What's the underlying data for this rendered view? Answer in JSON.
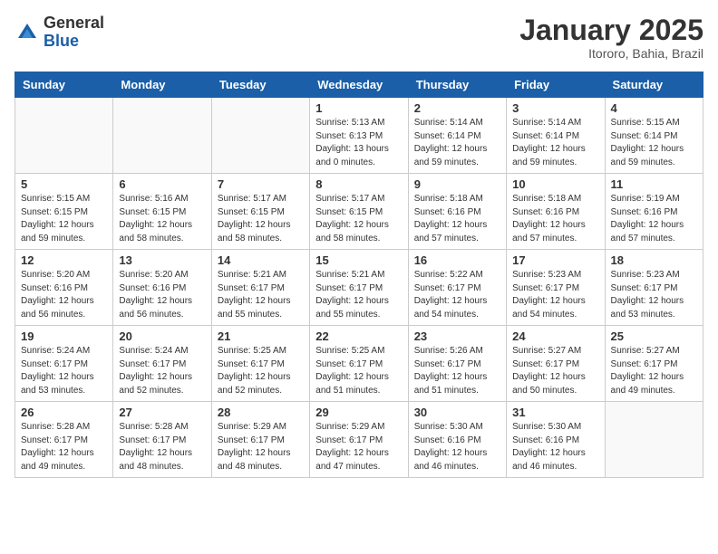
{
  "header": {
    "logo_general": "General",
    "logo_blue": "Blue",
    "month_title": "January 2025",
    "location": "Itororo, Bahia, Brazil"
  },
  "weekdays": [
    "Sunday",
    "Monday",
    "Tuesday",
    "Wednesday",
    "Thursday",
    "Friday",
    "Saturday"
  ],
  "weeks": [
    [
      {
        "day": "",
        "info": ""
      },
      {
        "day": "",
        "info": ""
      },
      {
        "day": "",
        "info": ""
      },
      {
        "day": "1",
        "info": "Sunrise: 5:13 AM\nSunset: 6:13 PM\nDaylight: 13 hours\nand 0 minutes."
      },
      {
        "day": "2",
        "info": "Sunrise: 5:14 AM\nSunset: 6:14 PM\nDaylight: 12 hours\nand 59 minutes."
      },
      {
        "day": "3",
        "info": "Sunrise: 5:14 AM\nSunset: 6:14 PM\nDaylight: 12 hours\nand 59 minutes."
      },
      {
        "day": "4",
        "info": "Sunrise: 5:15 AM\nSunset: 6:14 PM\nDaylight: 12 hours\nand 59 minutes."
      }
    ],
    [
      {
        "day": "5",
        "info": "Sunrise: 5:15 AM\nSunset: 6:15 PM\nDaylight: 12 hours\nand 59 minutes."
      },
      {
        "day": "6",
        "info": "Sunrise: 5:16 AM\nSunset: 6:15 PM\nDaylight: 12 hours\nand 58 minutes."
      },
      {
        "day": "7",
        "info": "Sunrise: 5:17 AM\nSunset: 6:15 PM\nDaylight: 12 hours\nand 58 minutes."
      },
      {
        "day": "8",
        "info": "Sunrise: 5:17 AM\nSunset: 6:15 PM\nDaylight: 12 hours\nand 58 minutes."
      },
      {
        "day": "9",
        "info": "Sunrise: 5:18 AM\nSunset: 6:16 PM\nDaylight: 12 hours\nand 57 minutes."
      },
      {
        "day": "10",
        "info": "Sunrise: 5:18 AM\nSunset: 6:16 PM\nDaylight: 12 hours\nand 57 minutes."
      },
      {
        "day": "11",
        "info": "Sunrise: 5:19 AM\nSunset: 6:16 PM\nDaylight: 12 hours\nand 57 minutes."
      }
    ],
    [
      {
        "day": "12",
        "info": "Sunrise: 5:20 AM\nSunset: 6:16 PM\nDaylight: 12 hours\nand 56 minutes."
      },
      {
        "day": "13",
        "info": "Sunrise: 5:20 AM\nSunset: 6:16 PM\nDaylight: 12 hours\nand 56 minutes."
      },
      {
        "day": "14",
        "info": "Sunrise: 5:21 AM\nSunset: 6:17 PM\nDaylight: 12 hours\nand 55 minutes."
      },
      {
        "day": "15",
        "info": "Sunrise: 5:21 AM\nSunset: 6:17 PM\nDaylight: 12 hours\nand 55 minutes."
      },
      {
        "day": "16",
        "info": "Sunrise: 5:22 AM\nSunset: 6:17 PM\nDaylight: 12 hours\nand 54 minutes."
      },
      {
        "day": "17",
        "info": "Sunrise: 5:23 AM\nSunset: 6:17 PM\nDaylight: 12 hours\nand 54 minutes."
      },
      {
        "day": "18",
        "info": "Sunrise: 5:23 AM\nSunset: 6:17 PM\nDaylight: 12 hours\nand 53 minutes."
      }
    ],
    [
      {
        "day": "19",
        "info": "Sunrise: 5:24 AM\nSunset: 6:17 PM\nDaylight: 12 hours\nand 53 minutes."
      },
      {
        "day": "20",
        "info": "Sunrise: 5:24 AM\nSunset: 6:17 PM\nDaylight: 12 hours\nand 52 minutes."
      },
      {
        "day": "21",
        "info": "Sunrise: 5:25 AM\nSunset: 6:17 PM\nDaylight: 12 hours\nand 52 minutes."
      },
      {
        "day": "22",
        "info": "Sunrise: 5:25 AM\nSunset: 6:17 PM\nDaylight: 12 hours\nand 51 minutes."
      },
      {
        "day": "23",
        "info": "Sunrise: 5:26 AM\nSunset: 6:17 PM\nDaylight: 12 hours\nand 51 minutes."
      },
      {
        "day": "24",
        "info": "Sunrise: 5:27 AM\nSunset: 6:17 PM\nDaylight: 12 hours\nand 50 minutes."
      },
      {
        "day": "25",
        "info": "Sunrise: 5:27 AM\nSunset: 6:17 PM\nDaylight: 12 hours\nand 49 minutes."
      }
    ],
    [
      {
        "day": "26",
        "info": "Sunrise: 5:28 AM\nSunset: 6:17 PM\nDaylight: 12 hours\nand 49 minutes."
      },
      {
        "day": "27",
        "info": "Sunrise: 5:28 AM\nSunset: 6:17 PM\nDaylight: 12 hours\nand 48 minutes."
      },
      {
        "day": "28",
        "info": "Sunrise: 5:29 AM\nSunset: 6:17 PM\nDaylight: 12 hours\nand 48 minutes."
      },
      {
        "day": "29",
        "info": "Sunrise: 5:29 AM\nSunset: 6:17 PM\nDaylight: 12 hours\nand 47 minutes."
      },
      {
        "day": "30",
        "info": "Sunrise: 5:30 AM\nSunset: 6:16 PM\nDaylight: 12 hours\nand 46 minutes."
      },
      {
        "day": "31",
        "info": "Sunrise: 5:30 AM\nSunset: 6:16 PM\nDaylight: 12 hours\nand 46 minutes."
      },
      {
        "day": "",
        "info": ""
      }
    ]
  ]
}
